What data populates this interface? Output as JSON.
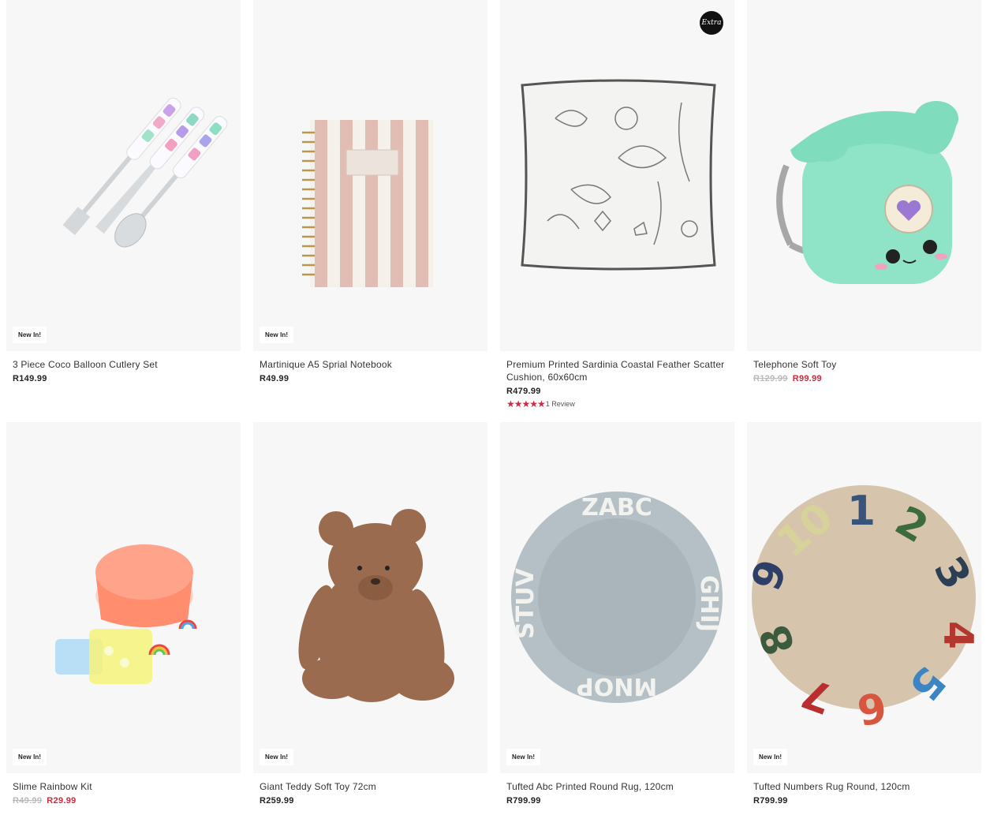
{
  "badges": {
    "new": "New In!",
    "extra": "Extra"
  },
  "products": [
    {
      "name": "3 Piece Coco Balloon Cutlery Set",
      "price": "R149.99",
      "old_price": "",
      "sale_price": "",
      "image": "cutlery-set"
    },
    {
      "name": "Martinique A5 Sprial Notebook",
      "price": "R49.99",
      "old_price": "",
      "sale_price": "",
      "image": "striped-notebook"
    },
    {
      "name": "Premium Printed Sardinia Coastal Feather Scatter Cushion, 60x60cm",
      "price": "R479.99",
      "old_price": "",
      "sale_price": "",
      "stars": "★★★★★",
      "rating": 5,
      "reviews": "1 Review",
      "image": "sea-print-cushion"
    },
    {
      "name": "Telephone Soft Toy",
      "price": "",
      "old_price": "R129.99",
      "sale_price": "R99.99",
      "image": "green-telephone-toy"
    },
    {
      "name": "Slime Rainbow Kit",
      "price": "",
      "old_price": "R49.99",
      "sale_price": "R29.99",
      "image": "slime-kit"
    },
    {
      "name": "Giant Teddy Soft Toy 72cm",
      "price": "R259.99",
      "old_price": "",
      "sale_price": "",
      "image": "teddy-bear"
    },
    {
      "name": "Tufted Abc Printed Round Rug, 120cm",
      "price": "R799.99",
      "old_price": "",
      "sale_price": "",
      "image": "abc-rug"
    },
    {
      "name": "Tufted Numbers Rug Round, 120cm",
      "price": "R799.99",
      "old_price": "",
      "sale_price": "",
      "image": "numbers-rug"
    }
  ],
  "colors": {
    "sale": "#d1293d",
    "old_price": "#b9b9b9",
    "image_bg": "#f7f7f7"
  }
}
